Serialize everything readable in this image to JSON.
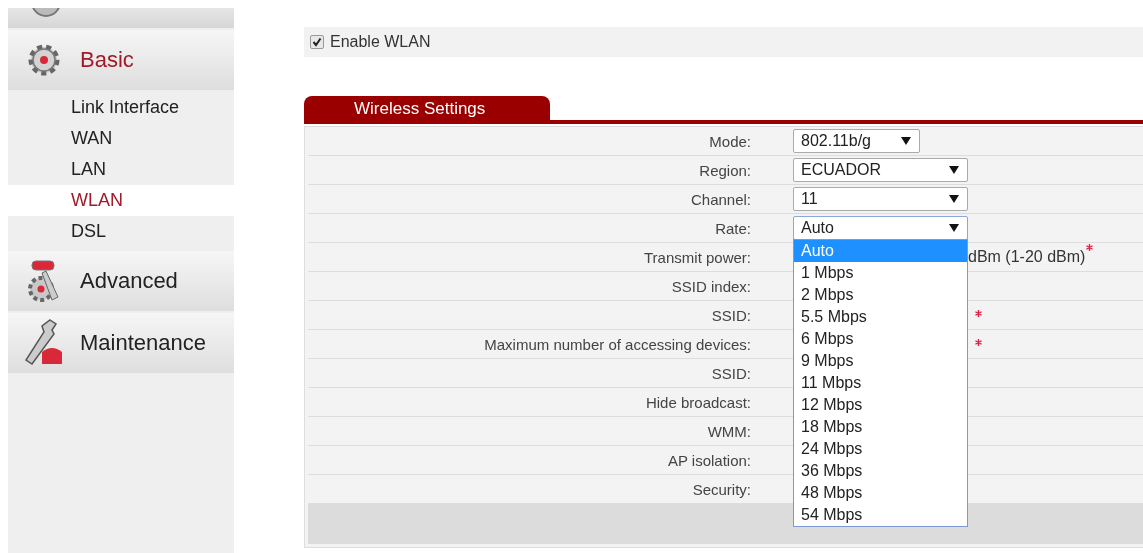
{
  "sidebar": {
    "groups": [
      {
        "label": "Basic",
        "selected": true,
        "items": [
          {
            "label": "Link Interface",
            "selected": false
          },
          {
            "label": "WAN",
            "selected": false
          },
          {
            "label": "LAN",
            "selected": false
          },
          {
            "label": "WLAN",
            "selected": true
          },
          {
            "label": "DSL",
            "selected": false
          }
        ]
      },
      {
        "label": "Advanced",
        "selected": false
      },
      {
        "label": "Maintenance",
        "selected": false
      }
    ]
  },
  "enable_wlan": {
    "label": "Enable WLAN",
    "checked": true
  },
  "section": {
    "title": "Wireless Settings"
  },
  "rows": [
    {
      "label": "Mode:",
      "kind": "select",
      "value": "802.11b/g"
    },
    {
      "label": "Region:",
      "kind": "select",
      "value": "ECUADOR"
    },
    {
      "label": "Channel:",
      "kind": "select",
      "value": "11"
    },
    {
      "label": "Rate:",
      "kind": "select",
      "value": "Auto",
      "options": [
        {
          "label": "Auto",
          "selected": true
        },
        {
          "label": "1 Mbps",
          "selected": false
        },
        {
          "label": "2 Mbps",
          "selected": false
        },
        {
          "label": "5.5 Mbps",
          "selected": false
        },
        {
          "label": "6 Mbps",
          "selected": false
        },
        {
          "label": "9 Mbps",
          "selected": false
        },
        {
          "label": "11 Mbps",
          "selected": false
        },
        {
          "label": "12 Mbps",
          "selected": false
        },
        {
          "label": "18 Mbps",
          "selected": false
        },
        {
          "label": "24 Mbps",
          "selected": false
        },
        {
          "label": "36 Mbps",
          "selected": false
        },
        {
          "label": "48 Mbps",
          "selected": false
        },
        {
          "label": "54 Mbps",
          "selected": false
        }
      ]
    },
    {
      "label": "Transmit power:",
      "kind": "text",
      "suffix": "dBm (1-20 dBm)",
      "required": true
    },
    {
      "label": "SSID index:",
      "kind": "text"
    },
    {
      "label": "SSID:",
      "kind": "text",
      "required": true
    },
    {
      "label": "Maximum number of accessing devices:",
      "kind": "text",
      "required": true
    },
    {
      "label": "SSID:",
      "kind": "text"
    },
    {
      "label": "Hide broadcast:",
      "kind": "text"
    },
    {
      "label": "WMM:",
      "kind": "text"
    },
    {
      "label": "AP isolation:",
      "kind": "text"
    },
    {
      "label": "Security:",
      "kind": "text"
    }
  ]
}
